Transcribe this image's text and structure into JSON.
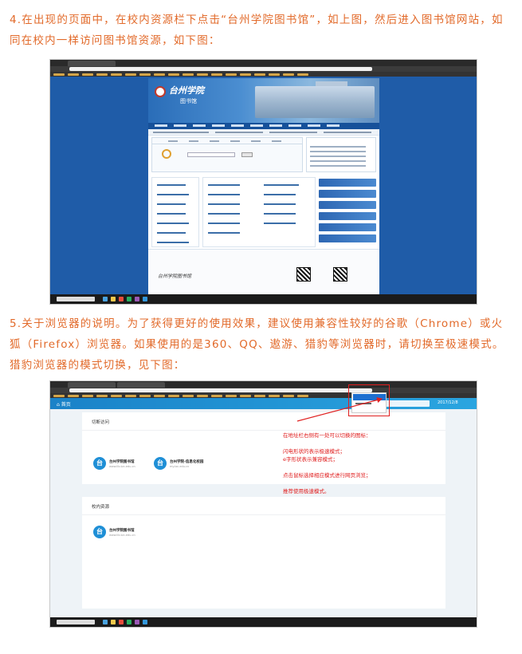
{
  "step4": {
    "text": "4.在出现的页面中，在校内资源栏下点击“台州学院图书馆”，如上图，然后进入图书馆网站，如同在校内一样访问图书馆资源，如下图："
  },
  "step5": {
    "text": "5.关于浏览器的说明。为了获得更好的使用效果，建议使用兼容性较好的谷歌（Chrome）或火狐（Firefox）浏览器。如果使用的是360、QQ、遨游、猎豹等浏览器时，请切换至极速模式。猎豹浏览器的模式切换，见下图："
  },
  "screenshot1": {
    "site_name": "台州学院",
    "site_sub": "图书馆",
    "footer_lib": "台州学院图书馆"
  },
  "screenshot2": {
    "home_label": "首页",
    "date_label": "2017/12/8",
    "panel1_title": "切断访问",
    "panel2_title": "校内资源",
    "tiles": [
      {
        "icon": "台",
        "name": "台州学院图书馆",
        "sub": "www.lib.tzc.edu.cn"
      },
      {
        "icon": "台",
        "name": "台州学院-信息化校园",
        "sub": "my.tzc.edu.cn"
      },
      {
        "icon": "台",
        "name": "台州学院图书馆",
        "sub": "www.lib.tzc.edu.cn"
      }
    ],
    "annotations": [
      "在地址栏右侧有一处可以切换的图标：",
      "闪电形状的表示极速模式；",
      "e字形状表示兼容模式；",
      "点击鼠标选择相应模式进行网页浏览；",
      "推荐使用极速模式。"
    ]
  },
  "colors": {
    "instruction_text": "#e26a2a",
    "annotation_red": "#e02020",
    "app_blue": "#1f8fd6"
  }
}
